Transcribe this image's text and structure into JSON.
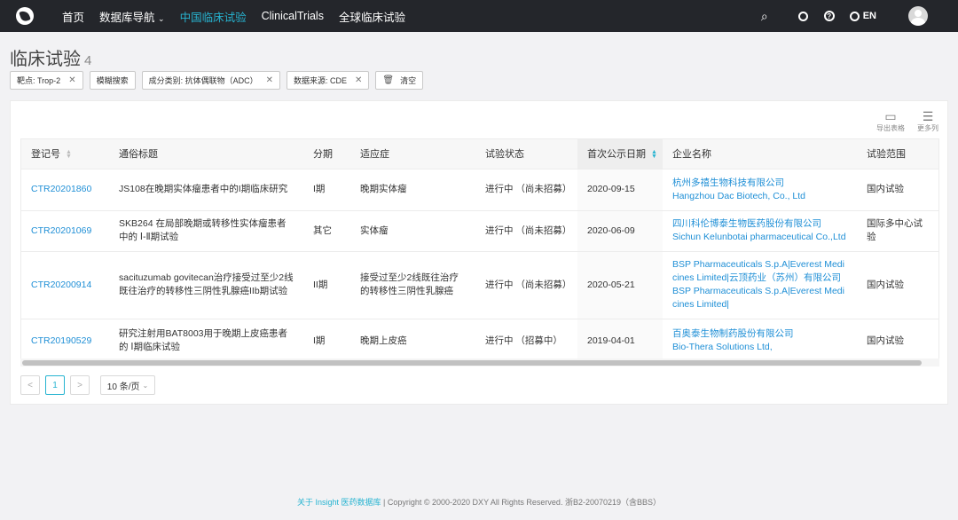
{
  "nav": {
    "home": "首页",
    "db_nav": "数据库导航",
    "items": [
      "中国临床试验",
      "ClinicalTrials",
      "全球临床试验"
    ],
    "lang": "EN"
  },
  "page": {
    "title": "临床试验",
    "count": "4"
  },
  "filters": [
    "靶点: Trop-2",
    "模糊搜索",
    "成分类别: 抗体偶联物（ADC）",
    "数据来源: CDE",
    "清空"
  ],
  "tools": {
    "export": "导出表格",
    "more_cols": "更多列"
  },
  "table": {
    "headers": [
      "登记号",
      "通俗标题",
      "分期",
      "适应症",
      "试验状态",
      "首次公示日期",
      "企业名称",
      "试验范围"
    ],
    "rows": [
      {
        "id": "CTR20201860",
        "title": "JS108在晚期实体瘤患者中的I期临床研究",
        "phase": "I期",
        "indication": "晚期实体瘤",
        "status": "进行中 （尚未招募）",
        "date": "2020-09-15",
        "company": "杭州多禧生物科技有限公司\nHangzhou Dac Biotech, Co., Ltd",
        "scope": "国内试验"
      },
      {
        "id": "CTR20201069",
        "title": "SKB264 在局部晚期或转移性实体瘤患者中的 Ⅰ-Ⅱ期试验",
        "phase": "其它",
        "indication": "实体瘤",
        "status": "进行中 （尚未招募）",
        "date": "2020-06-09",
        "company": "四川科伦博泰生物医药股份有限公司\nSichun Kelunbotai pharmaceutical Co.,Ltd",
        "scope": "国际多中心试验"
      },
      {
        "id": "CTR20200914",
        "title": "sacituzumab govitecan治疗接受过至少2线既往治疗的转移性三阴性乳腺癌IIb期试验",
        "phase": "II期",
        "indication": "接受过至少2线既往治疗的转移性三阴性乳腺癌",
        "status": "进行中 （尚未招募）",
        "date": "2020-05-21",
        "company": "BSP Pharmaceuticals S.p.A|Everest Medicines Limited|云顶药业（苏州）有限公司\nBSP Pharmaceuticals S.p.A|Everest Medicines Limited|",
        "scope": "国内试验"
      },
      {
        "id": "CTR20190529",
        "title": "研究注射用BAT8003用于晚期上皮癌患者的 Ⅰ期临床试验",
        "phase": "I期",
        "indication": "晚期上皮癌",
        "status": "进行中 （招募中）",
        "date": "2019-04-01",
        "company": "百奥泰生物制药股份有限公司\nBio-Thera Solutions Ltd,",
        "scope": "国内试验"
      }
    ]
  },
  "pagination": {
    "prev": "<",
    "current": "1",
    "next": ">",
    "page_size": "10 条/页"
  },
  "footer": {
    "link": "关于 Insight 医药数据库",
    "text": "| Copyright © 2000-2020 DXY All Rights Reserved. 浙B2-20070219（含BBS）"
  }
}
